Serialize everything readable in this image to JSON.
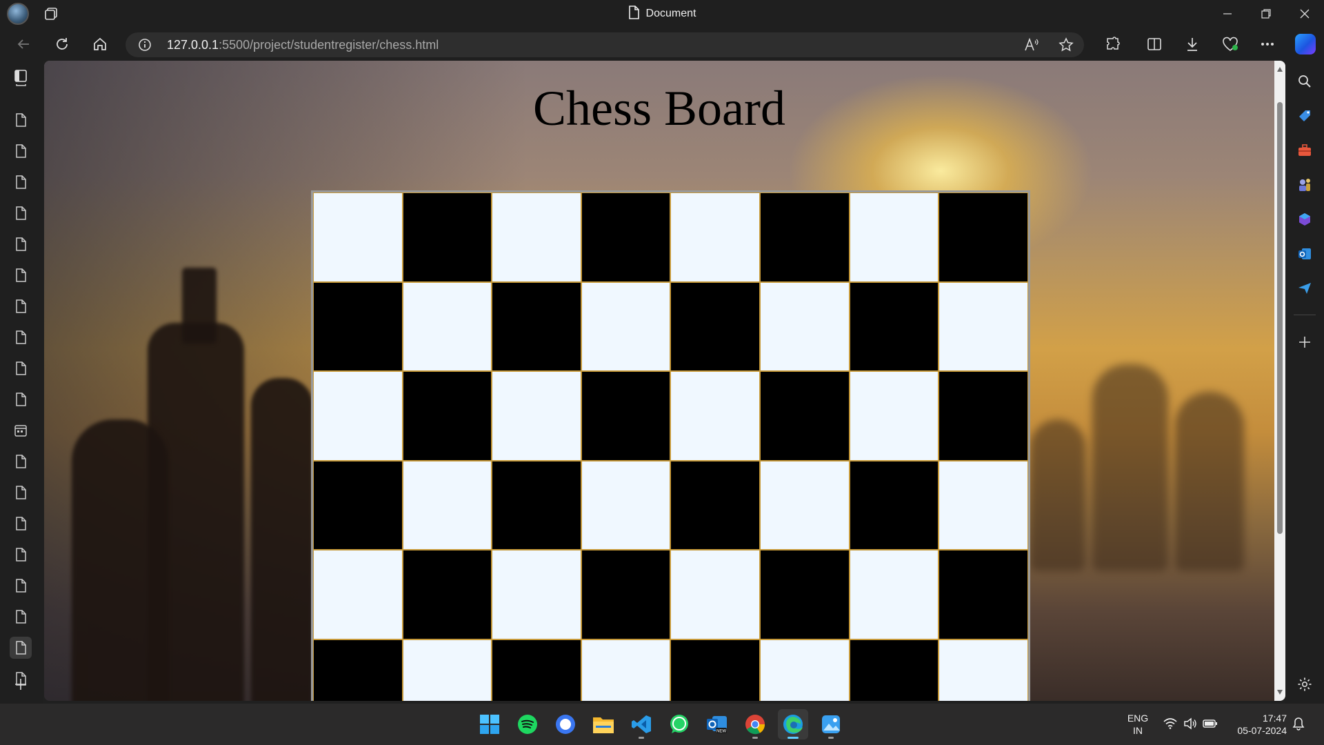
{
  "window": {
    "title": "Document"
  },
  "address_bar": {
    "url_host": "127.0.0.1",
    "url_rest": ":5500/project/studentregister/chess.html"
  },
  "page": {
    "heading": "Chess Board",
    "board": {
      "rows_visible": 6,
      "columns": 8,
      "top_left_color": "white",
      "light_square_color": "#f0f8ff",
      "dark_square_color": "#000000",
      "square_border_color": "#c79a3a"
    }
  },
  "vertical_tabs": {
    "items": [
      "tab-actions-icon",
      "page-icon",
      "page-icon",
      "page-icon",
      "page-icon",
      "page-icon",
      "page-icon",
      "page-icon",
      "page-icon",
      "page-icon",
      "page-icon",
      "calendar-page-icon",
      "page-icon",
      "page-icon",
      "page-icon",
      "page-icon",
      "page-icon",
      "page-icon",
      "page-icon",
      "page-icon"
    ],
    "active_index": 18,
    "new_tab_icon": "plus-icon"
  },
  "right_sidebar": {
    "items": [
      "search-icon",
      "shopping-tag-icon",
      "toolbox-icon",
      "games-icon",
      "microsoft-365-icon",
      "outlook-icon",
      "send-icon"
    ],
    "add_icon": "plus-icon",
    "settings_icon": "gear-icon"
  },
  "taskbar": {
    "apps": [
      "windows-start-icon",
      "spotify-icon",
      "signal-icon",
      "file-explorer-icon",
      "vscode-icon",
      "whatsapp-icon",
      "outlook-new-icon",
      "chrome-icon",
      "edge-icon",
      "photos-icon"
    ],
    "language_line1": "ENG",
    "language_line2": "IN",
    "time": "17:47",
    "date": "05-07-2024"
  }
}
